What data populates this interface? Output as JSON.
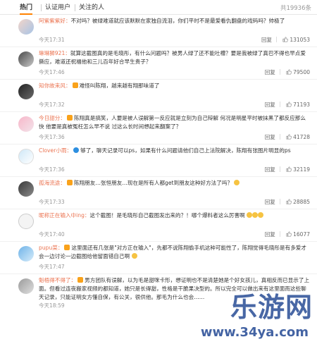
{
  "tabs": {
    "hot": "热门",
    "verified": "认证用户",
    "following": "关注的人",
    "total": "共19936条"
  },
  "actions": {
    "report": "回复"
  },
  "comments": [
    {
      "name": "阿紫紫紫好：",
      "text": "不对吗？被绿难道就应该默默在家独自流泪，你们平时不是最爱看仇翻盘的戏码吗？帅极了",
      "time": "今天17:31",
      "likes": "131053"
    },
    {
      "name": "琳琳狮921：",
      "text": "就算这截图真的是毛晓彤，有什么问题吗？被男人绿了还不能吐槽？要是我被绿了真巴不得也早点爱撕应，难道还祝福他和三儿百年好合早生贵子？",
      "time": "今天17:46",
      "likes": "79500"
    },
    {
      "name": "知你故来风：",
      "text": "难怪叫陈翔，越来越有翔那味道了",
      "time": "今天17:32",
      "likes": "71193"
    },
    {
      "name": "今日甜分：",
      "text": "陈翔真是搞笑，人要是被人误解第一反应就是立刻为自己辩解 何况是明星平时被抹黑了都反应那么快 他要是真被冤枉怎么早不说 过这么长时间想起来翻案了？",
      "time": "今天17:36",
      "likes": "41728"
    },
    {
      "name": "Clover小雨：",
      "text": "够了，聊天记录可以ps，如果有什么问题请他们自己上法院解决，陈翔有张图片明显的ps",
      "time": "今天17:36",
      "likes": "32119"
    },
    {
      "name": "孤海流途：",
      "text": "陈翔朋友…张恒朋友…现在是所有人都get到朋友这种好方法了吗？",
      "time": "今天17:33",
      "likes": "28885"
    },
    {
      "name": "昵称正在输入中ing：",
      "text": "这个截图！是毛晓彤自己截图发出来的？！哪个爆料者这么厉害啊",
      "time": "今天17:40",
      "likes": "16077"
    },
    {
      "name": "pupu菜：",
      "text": "这里面还有几张是\"对方正在输入\"，先都不说陈翔偷手机这种可能性了，陈翔觉得毛晓彤是有多爱才会一边讨论一边截图给他留面错自己啊",
      "time": "今天17:47",
      "likes": ""
    },
    {
      "name": "魁梧得不得了：",
      "text": "男方团队有误解，以为毛是甜咪卡形，想证明也不是清楚她是个好女孩儿，真相反而已显示了上面。但看过连夜搬家视频的都知道，她只是长得甜，性格是干脆果决型的。所以完全可以做出来有这里面而这些聊天记录，只能证明女方懂自保，有公关，很供他。那毛为什么也会……",
      "time": "今天18:59",
      "likes": ""
    }
  ],
  "watermark": {
    "title": "乐游网",
    "url": "www.34ya.com"
  },
  "colors": {
    "accent": "#ff8200",
    "name": "#eb7350",
    "watermark": "#143c8c"
  }
}
